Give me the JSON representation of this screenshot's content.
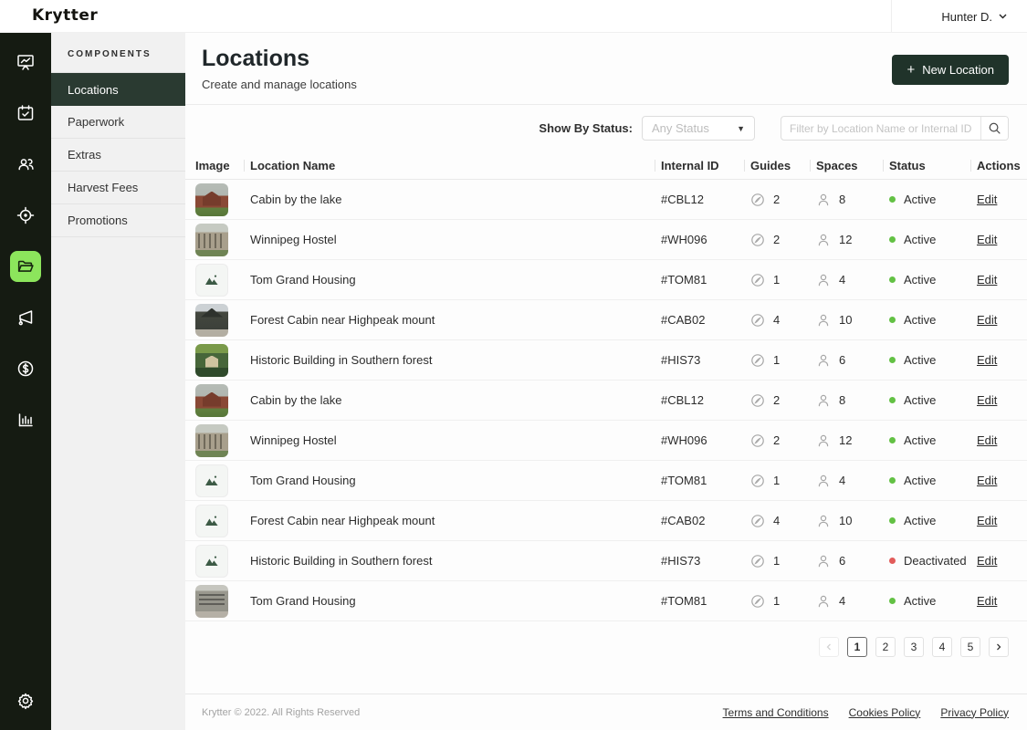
{
  "topbar": {
    "logo": "Krytter",
    "user_name": "Hunter D."
  },
  "rail": {
    "accent_color": "#8ce55c",
    "background_color": "#151b12",
    "icons": [
      "dashboard-icon",
      "tasks-calendar-icon",
      "users-icon",
      "locator-target-icon",
      "locations-folder-icon",
      "announcements-megaphone-icon",
      "payments-dollar-icon",
      "reports-chart-icon",
      "settings-gear-icon"
    ],
    "active_icon": "locations-folder-icon"
  },
  "sidebar": {
    "heading": "COMPONENTS",
    "items": [
      {
        "label": "Locations",
        "active": true
      },
      {
        "label": "Paperwork",
        "active": false
      },
      {
        "label": "Extras",
        "active": false
      },
      {
        "label": "Harvest Fees",
        "active": false
      },
      {
        "label": "Promotions",
        "active": false
      }
    ]
  },
  "page": {
    "title": "Locations",
    "subtitle": "Create and manage locations",
    "new_button_label": "New Location",
    "new_button_plus": "+"
  },
  "filters": {
    "status_label": "Show By Status:",
    "status_value": "Any Status",
    "search_placeholder": "Filter by Location Name or Internal ID"
  },
  "table": {
    "headers": {
      "image": "Image",
      "name": "Location Name",
      "internal_id": "Internal ID",
      "guides": "Guides",
      "spaces": "Spaces",
      "status": "Status",
      "actions": "Actions"
    },
    "edit_label": "Edit",
    "status_colors": {
      "active": "#63c144",
      "deactivated": "#e25c5a"
    },
    "rows": [
      {
        "name": "Cabin by the lake",
        "internal_id": "#CBL12",
        "guides": "2",
        "spaces": "8",
        "status": "Active",
        "thumbnail": "cabin-photo"
      },
      {
        "name": "Winnipeg Hostel",
        "internal_id": "#WH096",
        "guides": "2",
        "spaces": "12",
        "status": "Active",
        "thumbnail": "hostel-photo"
      },
      {
        "name": "Tom Grand Housing",
        "internal_id": "#TOM81",
        "guides": "1",
        "spaces": "4",
        "status": "Active",
        "thumbnail": "placeholder"
      },
      {
        "name": "Forest Cabin near Highpeak mount",
        "internal_id": "#CAB02",
        "guides": "4",
        "spaces": "10",
        "status": "Active",
        "thumbnail": "forest-photo"
      },
      {
        "name": "Historic Building in Southern forest",
        "internal_id": "#HIS73",
        "guides": "1",
        "spaces": "6",
        "status": "Active",
        "thumbnail": "historic-photo"
      },
      {
        "name": "Cabin by the lake",
        "internal_id": "#CBL12",
        "guides": "2",
        "spaces": "8",
        "status": "Active",
        "thumbnail": "cabin-photo"
      },
      {
        "name": "Winnipeg Hostel",
        "internal_id": "#WH096",
        "guides": "2",
        "spaces": "12",
        "status": "Active",
        "thumbnail": "hostel-photo"
      },
      {
        "name": "Tom Grand Housing",
        "internal_id": "#TOM81",
        "guides": "1",
        "spaces": "4",
        "status": "Active",
        "thumbnail": "placeholder"
      },
      {
        "name": "Forest Cabin near Highpeak mount",
        "internal_id": "#CAB02",
        "guides": "4",
        "spaces": "10",
        "status": "Active",
        "thumbnail": "placeholder"
      },
      {
        "name": "Historic Building in Southern forest",
        "internal_id": "#HIS73",
        "guides": "1",
        "spaces": "6",
        "status": "Deactivated",
        "thumbnail": "placeholder"
      },
      {
        "name": "Tom Grand Housing",
        "internal_id": "#TOM81",
        "guides": "1",
        "spaces": "4",
        "status": "Active",
        "thumbnail": "tom-photo"
      }
    ]
  },
  "pagination": {
    "prev": "<",
    "pages": [
      "1",
      "2",
      "3",
      "4",
      "5"
    ],
    "active_page": "1",
    "next": ">"
  },
  "footer": {
    "copyright": "Krytter © 2022. All Rights Reserved",
    "links": [
      "Terms and Conditions",
      "Cookies Policy",
      "Privacy Policy"
    ]
  }
}
